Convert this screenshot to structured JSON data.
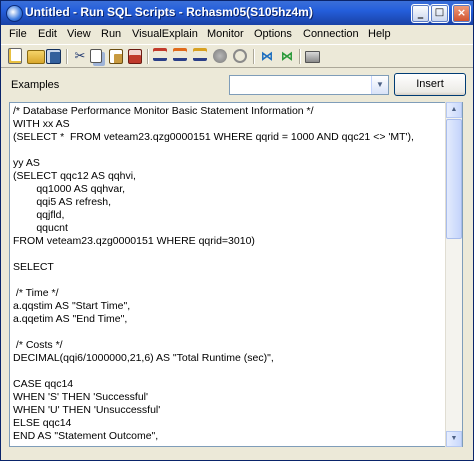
{
  "window": {
    "title": "Untitled - Run SQL Scripts - Rchasm05(S105hz4m)",
    "minimize": "_",
    "maximize": "□",
    "close": "×"
  },
  "menu": [
    "File",
    "Edit",
    "View",
    "Run",
    "VisualExplain",
    "Monitor",
    "Options",
    "Connection",
    "Help"
  ],
  "toolbar": {
    "icons": [
      "new-icon",
      "open-icon",
      "save-icon",
      "cut-icon",
      "copy-icon",
      "paste-icon",
      "print-icon",
      "run-all-icon",
      "run-from-selected-icon",
      "run-selected-icon",
      "stop-icon",
      "cancel-icon",
      "explain-icon",
      "run-and-explain-icon",
      "connection-icon"
    ]
  },
  "examples": {
    "label": "Examples",
    "selected": "",
    "insert_label": "Insert"
  },
  "editor": {
    "lines": [
      "/* Database Performance Monitor Basic Statement Information */",
      "WITH xx AS",
      "(SELECT *  FROM veteam23.qzg0000151 WHERE qqrid = 1000 AND qqc21 <> 'MT'),",
      "",
      "yy AS",
      "(SELECT qqc12 AS qqhvi,",
      "        qq1000 AS qqhvar,",
      "        qqi5 AS refresh,",
      "        qqjfld,",
      "        qqucnt",
      "FROM veteam23.qzg0000151 WHERE qqrid=3010)",
      "",
      "SELECT",
      "",
      " /* Time */",
      "a.qqstim AS \"Start Time\",",
      "a.qqetim AS \"End Time\",",
      "",
      " /* Costs */",
      "DECIMAL(qqi6/1000000,21,6) AS \"Total Runtime (sec)\",",
      "",
      "CASE qqc14",
      "WHEN 'S' THEN 'Successful'",
      "WHEN 'U' THEN 'Unsuccessful'",
      "ELSE qqc14",
      "END AS \"Statement Outcome\","
    ]
  }
}
